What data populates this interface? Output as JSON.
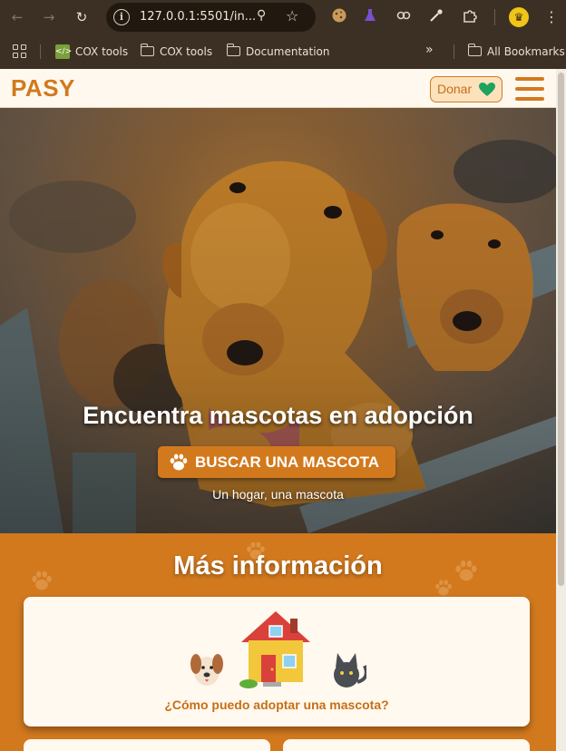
{
  "browser": {
    "url": "127.0.0.1:5501/in...",
    "bookmarks": [
      {
        "label": "COX tools",
        "icon": "code-icon"
      },
      {
        "label": "COX tools",
        "icon": "folder-icon"
      },
      {
        "label": "Documentation",
        "icon": "folder-icon"
      }
    ],
    "all_bookmarks_label": "All Bookmarks"
  },
  "header": {
    "logo": "PASY",
    "donate_label": "Donar"
  },
  "hero": {
    "title": "Encuentra mascotas en adopción",
    "button_label": "BUSCAR UNA MASCOTA",
    "subtitle": "Un hogar, una mascota"
  },
  "info": {
    "title": "Más información",
    "card_title": "¿Cómo puedo adoptar una mascota?"
  },
  "colors": {
    "brand": "#d2791e",
    "header_bg": "#fff8ee",
    "heart": "#1fa35c",
    "card_bg": "#fff9ef"
  }
}
